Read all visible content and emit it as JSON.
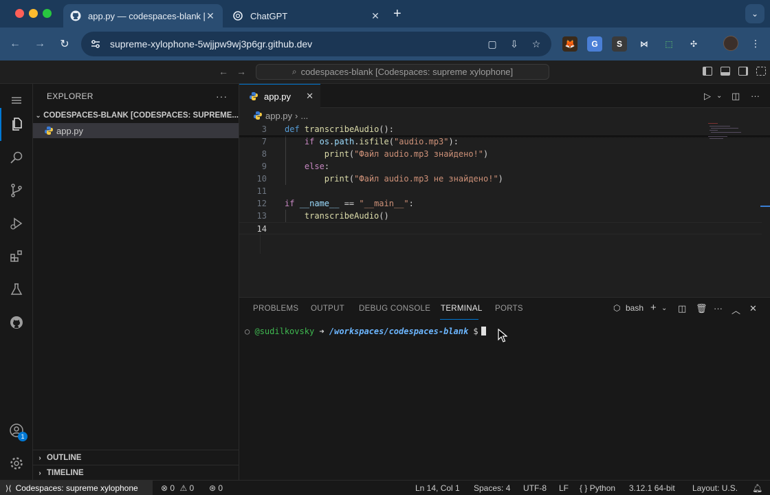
{
  "browser": {
    "tabs": [
      {
        "title": "app.py — codespaces-blank [",
        "active": true
      },
      {
        "title": "ChatGPT",
        "active": false
      }
    ],
    "url": "supreme-xylophone-5wjjpw9wj3p6gr.github.dev"
  },
  "titlebar": {
    "command_center": "codespaces-blank [Codespaces: supreme xylophone]"
  },
  "sidebar": {
    "title": "EXPLORER",
    "workspace": "CODESPACES-BLANK [CODESPACES: SUPREME...",
    "files": [
      "app.py"
    ],
    "outline": "OUTLINE",
    "timeline": "TIMELINE"
  },
  "activity": {
    "accounts_badge": "1"
  },
  "editor": {
    "tab": "app.py",
    "breadcrumb_file": "app.py",
    "breadcrumb_more": "...",
    "line_numbers": [
      "3",
      "7",
      "8",
      "9",
      "10",
      "11",
      "12",
      "13",
      "14"
    ],
    "code": {
      "l3": {
        "kw": "def",
        "fn": "transcribeAudio",
        "rest": "():"
      },
      "l7": {
        "kw": "if",
        "var1": "os",
        "dot1": ".",
        "var2": "path",
        "dot2": ".",
        "fn": "isfile",
        "open": "(",
        "str": "\"audio.mp3\"",
        "close": "):"
      },
      "l8": {
        "fn": "print",
        "open": "(",
        "str": "\"Файл audio.mp3 знайдено!\"",
        "close": ")"
      },
      "l9": {
        "kw": "else",
        "rest": ":"
      },
      "l10": {
        "fn": "print",
        "open": "(",
        "str": "\"Файл audio.mp3 не знайдено!\"",
        "close": ")"
      },
      "l12": {
        "kw": "if",
        "var": "__name__",
        "op": " == ",
        "str": "\"__main__\"",
        "rest": ":"
      },
      "l13": {
        "fn": "transcribeAudio",
        "rest": "()"
      }
    }
  },
  "panel": {
    "tabs": [
      "PROBLEMS",
      "OUTPUT",
      "DEBUG CONSOLE",
      "TERMINAL",
      "PORTS"
    ],
    "active_tab": "TERMINAL",
    "shell": "bash",
    "prompt": {
      "circle": "○",
      "user": "@sudilkovsky",
      "arrow": "➜",
      "path": "/workspaces/codespaces-blank",
      "dollar": "$"
    }
  },
  "statusbar": {
    "remote": "Codespaces: supreme xylophone",
    "errors": "0",
    "warnings": "0",
    "ports": "0",
    "position": "Ln 14, Col 1",
    "spaces": "Spaces: 4",
    "encoding": "UTF-8",
    "eol": "LF",
    "language": "Python",
    "interpreter": "3.12.1 64-bit",
    "layout": "Layout: U.S."
  },
  "colors": {
    "accent": "#0078d4",
    "browser_tab_bg": "#1c3a5a",
    "editor_bg": "#1f1f1f"
  }
}
